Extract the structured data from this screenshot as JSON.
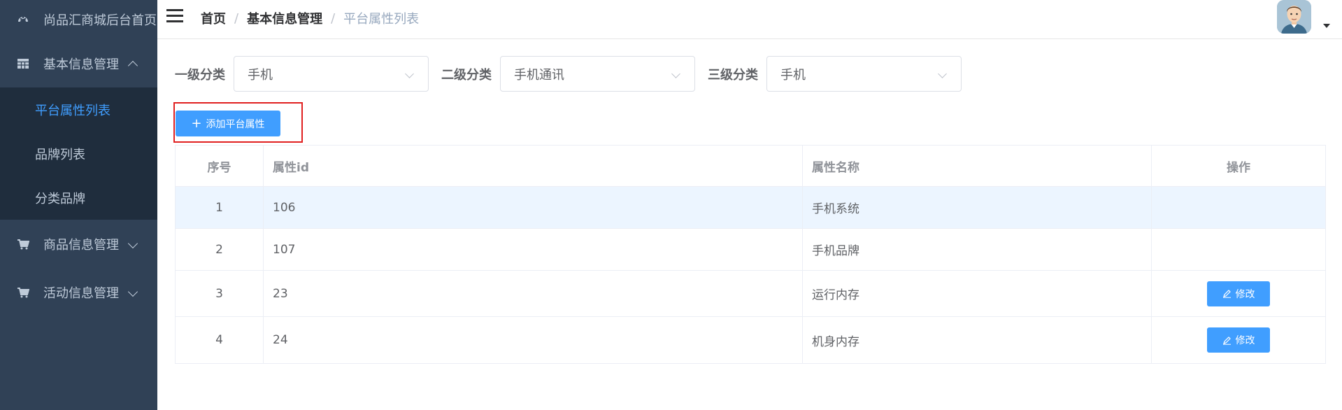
{
  "sidebar": {
    "home": "尚品汇商城后台首页",
    "menus": [
      {
        "label": "基本信息管理",
        "expanded": true,
        "items": [
          "平台属性列表",
          "品牌列表",
          "分类品牌"
        ]
      },
      {
        "label": "商品信息管理",
        "expanded": false
      },
      {
        "label": "活动信息管理",
        "expanded": false
      }
    ]
  },
  "breadcrumb": [
    "首页",
    "基本信息管理",
    "平台属性列表"
  ],
  "breadcrumb_separator": "/",
  "filter": {
    "level1": {
      "label": "一级分类",
      "value": "手机"
    },
    "level2": {
      "label": "二级分类",
      "value": "手机通讯"
    },
    "level3": {
      "label": "三级分类",
      "value": "手机"
    }
  },
  "add_button": {
    "label": "添加平台属性",
    "icon": "plus-icon"
  },
  "table": {
    "headers": [
      "序号",
      "属性id",
      "属性名称",
      "操作"
    ],
    "rows": [
      {
        "index": "1",
        "id": "106",
        "name": "手机系统",
        "action": ""
      },
      {
        "index": "2",
        "id": "107",
        "name": "手机品牌",
        "action": ""
      },
      {
        "index": "3",
        "id": "23",
        "name": "运行内存",
        "action": "修改"
      },
      {
        "index": "4",
        "id": "24",
        "name": "机身内存",
        "action": "修改"
      }
    ]
  },
  "colors": {
    "primary": "#409eff",
    "sidebar_bg": "#304156",
    "submenu_bg": "#1f2d3d",
    "highlight": "#e02020"
  }
}
